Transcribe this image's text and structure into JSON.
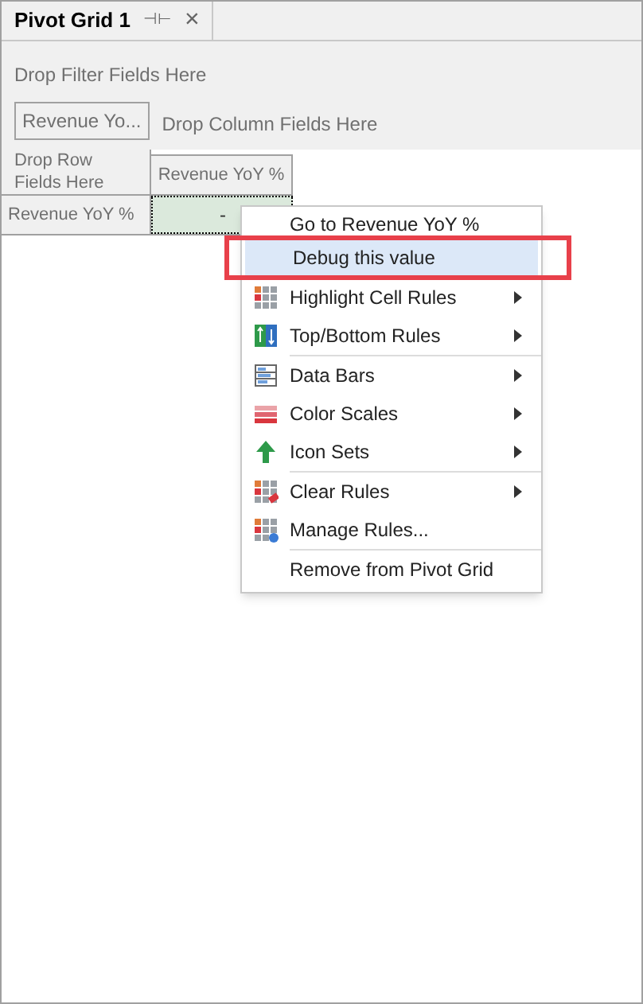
{
  "tab": {
    "title": "Pivot Grid 1",
    "pin": "⊣⊢",
    "close": "×"
  },
  "filter_area": {
    "placeholder": "Drop Filter Fields Here"
  },
  "data_field": "Revenue Yo...",
  "column_area": {
    "placeholder": "Drop Column Fields Here"
  },
  "row_area": {
    "placeholder": "Drop Row Fields Here"
  },
  "column_header": "Revenue YoY %",
  "row_header": "Revenue YoY %",
  "cell": "-",
  "context_menu": {
    "groups": [
      [
        {
          "label": "Go to Revenue YoY %",
          "selected": false,
          "submenu": false
        },
        {
          "label": "Debug this value",
          "selected": true,
          "submenu": false
        }
      ],
      [
        {
          "label": "Highlight Cell Rules",
          "selected": false,
          "submenu": true
        },
        {
          "label": "Top/Bottom Rules",
          "selected": false,
          "submenu": true
        }
      ],
      [
        {
          "label": "Data Bars",
          "selected": false,
          "submenu": true
        },
        {
          "label": "Color Scales",
          "selected": false,
          "submenu": true
        },
        {
          "label": "Icon Sets",
          "selected": false,
          "submenu": true
        }
      ],
      [
        {
          "label": "Clear Rules",
          "selected": false,
          "submenu": true
        },
        {
          "label": "Manage Rules...",
          "selected": false,
          "submenu": false
        }
      ],
      [
        {
          "label": "Remove from Pivot Grid",
          "selected": false,
          "submenu": false
        }
      ]
    ]
  }
}
